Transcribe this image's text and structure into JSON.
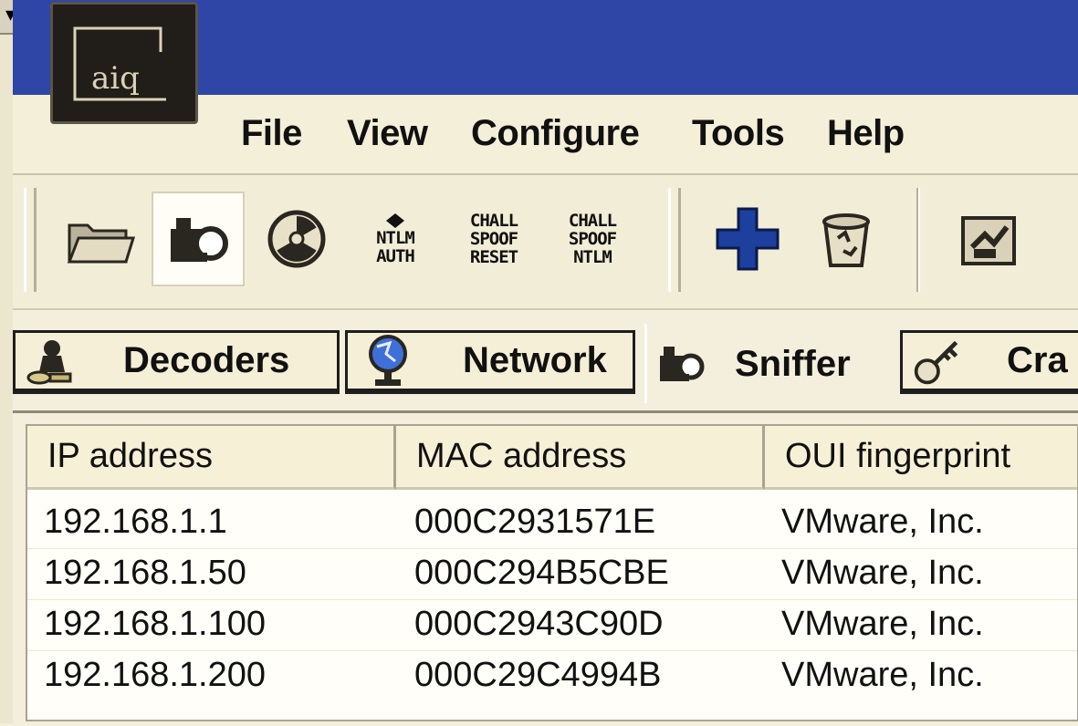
{
  "menu": {
    "items": [
      "File",
      "View",
      "Configure",
      "Tools",
      "Help"
    ]
  },
  "toolbar": {
    "buttons": [
      {
        "icon": "open-folder-icon"
      },
      {
        "icon": "sniffer-icon",
        "pressed": true
      },
      {
        "icon": "radiation-icon"
      },
      {
        "icon": "ntlm-auth-icon",
        "text": [
          "NTLM",
          "AUTH"
        ]
      },
      {
        "icon": "chall-spoof-reset-icon",
        "text": [
          "CHALL",
          "SPOOF",
          "RESET"
        ]
      },
      {
        "icon": "chall-spoof-ntlm-icon",
        "text": [
          "CHALL",
          "SPOOF",
          "NTLM"
        ]
      },
      {
        "icon": "add-icon"
      },
      {
        "icon": "recycle-bin-icon"
      },
      {
        "icon": "network-map-icon"
      }
    ]
  },
  "tabs": [
    {
      "label": "Decoders",
      "icon": "decoders-icon"
    },
    {
      "label": "Network",
      "icon": "network-icon"
    },
    {
      "label": "Sniffer",
      "icon": "sniffer-tab-icon",
      "active": true
    },
    {
      "label": "Cra",
      "icon": "cracker-icon"
    }
  ],
  "table": {
    "columns": [
      "IP address",
      "MAC address",
      "OUI fingerprint"
    ],
    "rows": [
      [
        "192.168.1.1",
        "000C2931571E",
        "VMware, Inc."
      ],
      [
        "192.168.1.50",
        "000C294B5CBE",
        "VMware, Inc."
      ],
      [
        "192.168.1.100",
        "000C2943C90D",
        "VMware, Inc."
      ],
      [
        "192.168.1.200",
        "000C29C4994B",
        "VMware, Inc."
      ]
    ]
  },
  "colors": {
    "titlebar": "#2f46a6",
    "background": "#f4efdc",
    "accent_blue": "#1d3f9e"
  }
}
